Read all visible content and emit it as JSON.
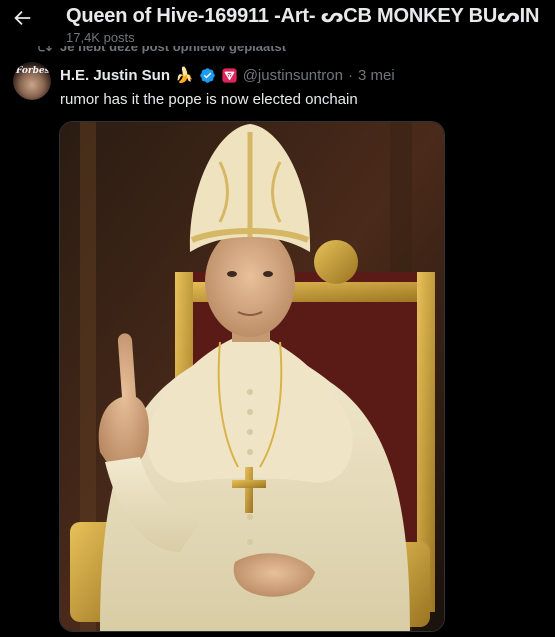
{
  "header": {
    "title": "Queen of Hive-169911 -Art- ᔕCB MONKEY BUᔕIN",
    "post_count": "17,4K posts"
  },
  "repost": {
    "text": "Je hebt deze post opnieuw geplaatst"
  },
  "post": {
    "avatar_text": "Forbes",
    "author_name": "H.E. Justin Sun",
    "author_emoji": "🍌",
    "handle": "@justinsuntron",
    "separator": "·",
    "time": "3 mei",
    "text": "rumor has it the pope is now elected onchain",
    "media": {
      "description_icon": "image"
    }
  },
  "colors": {
    "background": "#000000",
    "text_primary": "#e7e9ea",
    "text_secondary": "#71767b",
    "verified": "#1d9bf0",
    "affiliate_badge": "#e0245e"
  }
}
